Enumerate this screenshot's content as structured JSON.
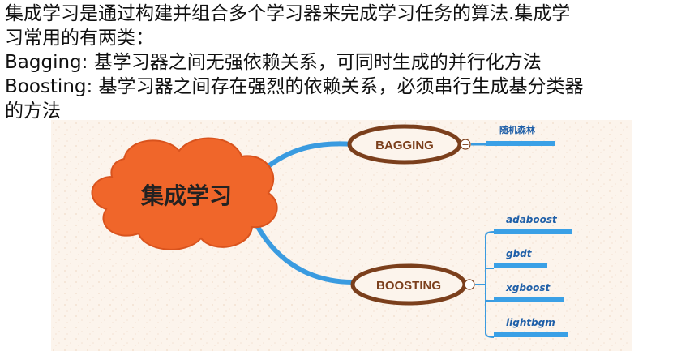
{
  "text": {
    "line1": "集成学习是通过构建并组合多个学习器来完成学习任务的算法.集成学",
    "line2": "习常用的有两类：",
    "line3": "Bagging: 基学习器之间无强依赖关系，可同时生成的并行化方法",
    "line4": "Boosting: 基学习器之间存在强烈的依赖关系，必须串行生成基分类器",
    "line5": "的方法"
  },
  "mindmap": {
    "central": "集成学习",
    "bagging": {
      "label": "BAGGING",
      "children": [
        "随机森林"
      ]
    },
    "boosting": {
      "label": "BOOSTING",
      "children": [
        "adaboost",
        "gbdt",
        "xgboost",
        "lightbgm"
      ]
    },
    "collapse_symbol": "−",
    "colors": {
      "background": "#fcf4ec",
      "cloud_fill": "#f0662a",
      "cloud_stroke": "#d9531d",
      "connector": "#3a9be0",
      "node_border": "#7b3f1c",
      "node_text": "#7b3f1c",
      "child_text": "#1f5fa8",
      "child_bar": "#3aa0e6"
    }
  }
}
